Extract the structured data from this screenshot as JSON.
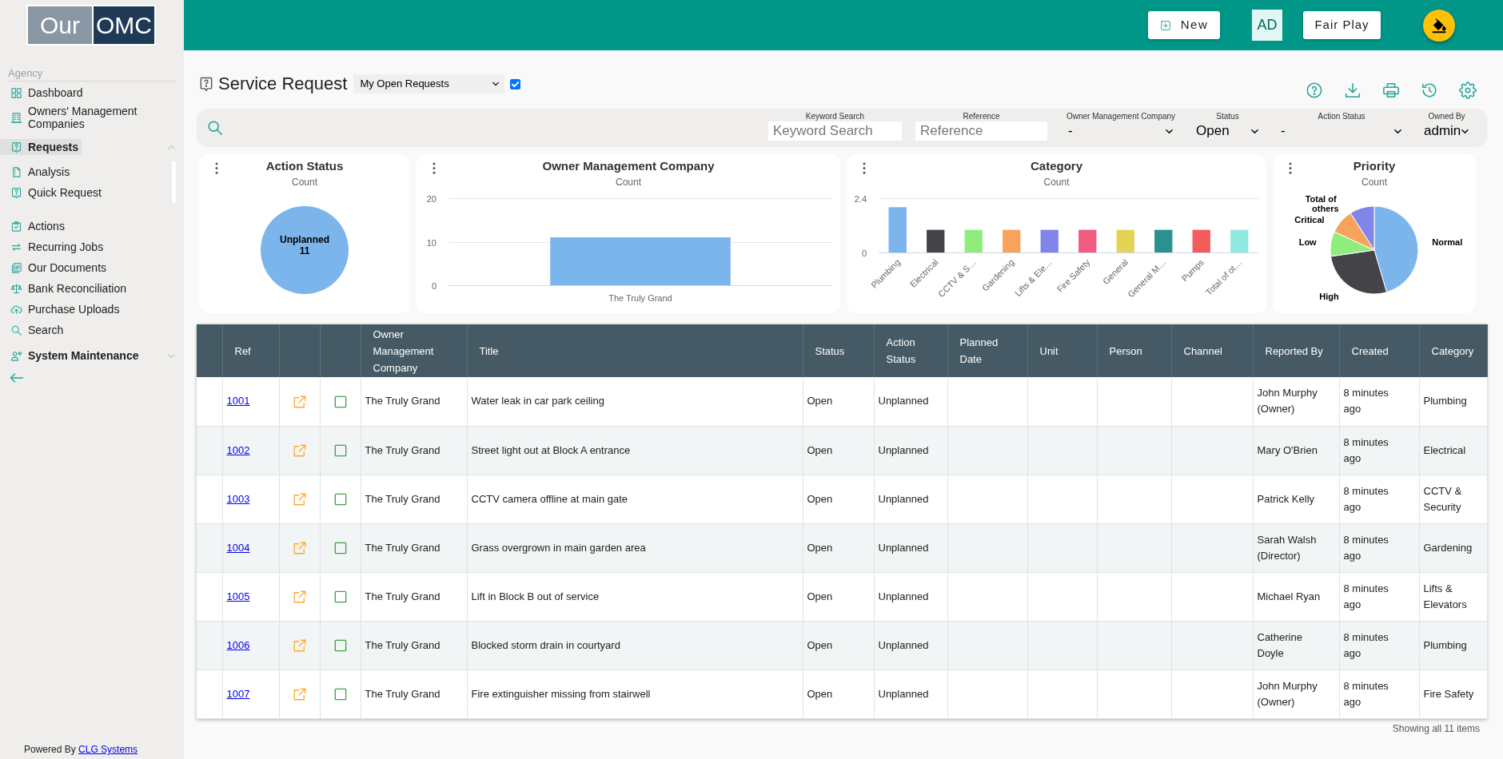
{
  "top_bar": {
    "new_button": "New",
    "user_initials": "AD",
    "account_button": "Fair Play"
  },
  "sidebar": {
    "logo": {
      "left": "Our",
      "right": "OMC"
    },
    "section": "Agency",
    "items": [
      {
        "label": "Dashboard",
        "selected": false
      },
      {
        "label": "Owners' Management Companies",
        "selected": false
      },
      {
        "label": "Requests",
        "selected": true,
        "expanded": true,
        "children": [
          {
            "label": "Analysis",
            "selected": false
          },
          {
            "label": "Quick Request",
            "selected": false
          }
        ]
      },
      {
        "label": "Actions",
        "selected": false
      },
      {
        "label": "Recurring Jobs",
        "selected": false
      },
      {
        "label": "Our Documents",
        "selected": false
      },
      {
        "label": "Bank Reconciliation",
        "selected": false
      },
      {
        "label": "Purchase Uploads",
        "selected": false
      },
      {
        "label": "Search",
        "selected": false
      },
      {
        "label": "System Maintenance",
        "selected": false,
        "expanded": false
      }
    ],
    "footer": {
      "text": "Powered By",
      "link": "CLG Systems"
    }
  },
  "header": {
    "title": "Service Request",
    "view_select": "My Open Requests",
    "checkbox": {
      "checked": true
    }
  },
  "filters": [
    {
      "kind": "text",
      "label": "Keyword Search",
      "placeholder": "Keyword Search"
    },
    {
      "kind": "text",
      "label": "Reference",
      "placeholder": "Reference"
    },
    {
      "kind": "select",
      "label": "Owner Management Company",
      "value": "-"
    },
    {
      "kind": "select",
      "label": "Status",
      "value": "Open"
    },
    {
      "kind": "select",
      "label": "Action Status",
      "value": "-"
    },
    {
      "kind": "select",
      "label": "Owned By",
      "value": "admin"
    }
  ],
  "charts": [
    {
      "subtitle": "Count",
      "chart_data": {
        "type": "pie",
        "title": "Action Status",
        "categories": [
          "Unplanned"
        ],
        "values": [
          11
        ],
        "colors": [
          "#7cb5ec"
        ],
        "data_labels": true
      }
    },
    {
      "subtitle": "Count",
      "chart_data": {
        "type": "bar",
        "title": "Owner Management Company",
        "categories": [
          "The Truly Grand"
        ],
        "values": [
          11
        ],
        "colors": [
          "#7cb5ec"
        ],
        "ylim": [
          0,
          20
        ],
        "yticks": [
          0,
          10,
          20
        ]
      }
    },
    {
      "subtitle": "Count",
      "chart_data": {
        "type": "bar",
        "title": "Category",
        "categories": [
          "Plumbing",
          "Electrical",
          "CCTV & S…",
          "Gardening",
          "Lifts & Ele…",
          "Fire Safety",
          "General",
          "General M…",
          "Pumps",
          "Total of ot…"
        ],
        "values": [
          2,
          1,
          1,
          1,
          1,
          1,
          1,
          1,
          1,
          1
        ],
        "colors": [
          "#7cb5ec",
          "#434348",
          "#90ed7d",
          "#f7a35c",
          "#8085e9",
          "#f15c80",
          "#e4d354",
          "#2b908f",
          "#f45b5b",
          "#91e8e1"
        ],
        "ylim": [
          0,
          2.4
        ],
        "yticks": [
          0,
          2.4
        ]
      }
    },
    {
      "subtitle": "Count",
      "chart_data": {
        "type": "pie",
        "title": "Priority",
        "categories": [
          "Normal",
          "High",
          "Low",
          "Critical",
          "Total of others"
        ],
        "values": [
          45.45,
          27.28,
          9.09,
          9.09,
          9.09
        ],
        "colors": [
          "#7cb5ec",
          "#434348",
          "#90ed7d",
          "#f7a35c",
          "#8085e9"
        ]
      }
    }
  ],
  "table": {
    "columns": [
      "Ref",
      "Owner Management Company",
      "Title",
      "Status",
      "Action Status",
      "Planned Date",
      "Unit",
      "Person",
      "Channel",
      "Reported By",
      "Created",
      "Category"
    ],
    "rows": [
      {
        "ref": "1001",
        "checked": false,
        "owner_management_company": "The Truly Grand",
        "title": "Water leak in car park ceiling",
        "status": "Open",
        "action_status": "Unplanned",
        "reported_by": "John Murphy (Owner)",
        "created": "8 minutes ago",
        "category": "Plumbing"
      },
      {
        "ref": "1002",
        "checked": false,
        "owner_management_company": "The Truly Grand",
        "title": "Street light out at Block A entrance",
        "status": "Open",
        "action_status": "Unplanned",
        "reported_by": "Mary O'Brien",
        "created": "8 minutes ago",
        "category": "Electrical"
      },
      {
        "ref": "1003",
        "checked": false,
        "owner_management_company": "The Truly Grand",
        "title": "CCTV camera offline at main gate",
        "status": "Open",
        "action_status": "Unplanned",
        "reported_by": "Patrick Kelly",
        "created": "8 minutes ago",
        "category": "CCTV & Security"
      },
      {
        "ref": "1004",
        "checked": false,
        "owner_management_company": "The Truly Grand",
        "title": "Grass overgrown in main garden area",
        "status": "Open",
        "action_status": "Unplanned",
        "reported_by": "Sarah Walsh (Director)",
        "created": "8 minutes ago",
        "category": "Gardening"
      },
      {
        "ref": "1005",
        "checked": false,
        "owner_management_company": "The Truly Grand",
        "title": "Lift in Block B out of service",
        "status": "Open",
        "action_status": "Unplanned",
        "reported_by": "Michael Ryan",
        "created": "8 minutes ago",
        "category": "Lifts & Elevators"
      },
      {
        "ref": "1006",
        "checked": false,
        "owner_management_company": "The Truly Grand",
        "title": "Blocked storm drain in courtyard",
        "status": "Open",
        "action_status": "Unplanned",
        "reported_by": "Catherine Doyle",
        "created": "8 minutes ago",
        "category": "Plumbing"
      },
      {
        "ref": "1007",
        "checked": false,
        "owner_management_company": "The Truly Grand",
        "title": "Fire extinguisher missing from stairwell",
        "status": "Open",
        "action_status": "Unplanned",
        "reported_by": "John Murphy (Owner)",
        "created": "8 minutes ago",
        "category": "Fire Safety"
      }
    ],
    "footer": "Showing all 11 items"
  }
}
